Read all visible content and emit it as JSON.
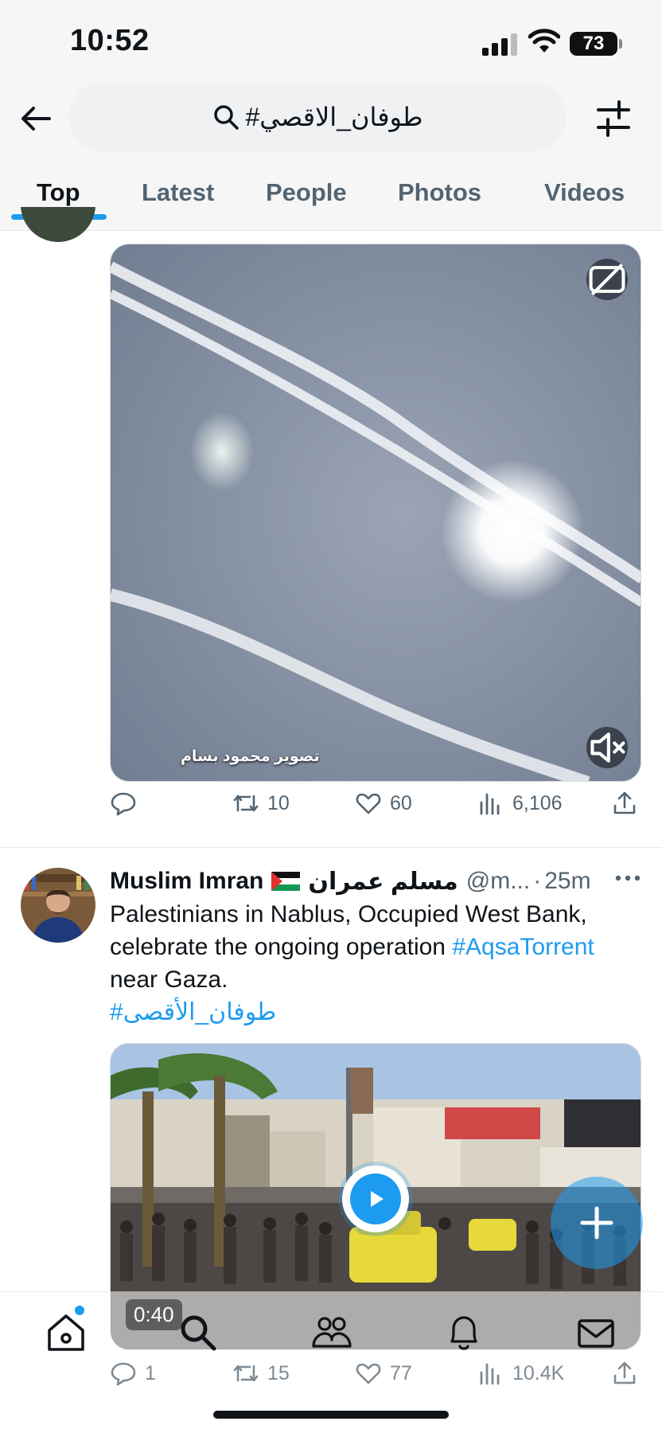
{
  "status": {
    "time": "10:52",
    "battery": "73"
  },
  "header": {
    "search_query": "#طوفان_الاقصي"
  },
  "tabs": [
    "Top",
    "Latest",
    "People",
    "Photos",
    "Videos"
  ],
  "tweet1": {
    "video_watermark": "تصوير محمود بسام",
    "replies": "",
    "retweets": "10",
    "likes": "60",
    "views": "6,106"
  },
  "tweet2": {
    "name": "Muslim Imran",
    "name_ar": "مسلم عمران",
    "handle": "@m...",
    "separator": "·",
    "time": "25m",
    "text_1": "Palestinians in Nablus, Occupied West Bank, celebrate the ongoing operation ",
    "hashtag_1": "#AqsaTorrent",
    "text_2": " near Gaza.",
    "hashtag_ar": "#طوفان_الأقصى",
    "video_duration": "0:40",
    "replies": "1",
    "retweets": "15",
    "likes": "77",
    "views": "10.4K"
  },
  "colors": {
    "accent": "#1d9bf0",
    "text": "#0f1419",
    "secondary": "#536471"
  },
  "icons": {
    "back": "arrow-left-icon",
    "search": "search-icon",
    "filter": "sliders-icon",
    "captions": "captions-off-icon",
    "mute": "volume-mute-icon",
    "reply": "comment-icon",
    "retweet": "retweet-icon",
    "like": "heart-icon",
    "views": "bar-chart-icon",
    "share": "share-icon",
    "nav": [
      "home-icon",
      "search-icon",
      "communities-icon",
      "bell-icon",
      "mail-icon"
    ]
  }
}
